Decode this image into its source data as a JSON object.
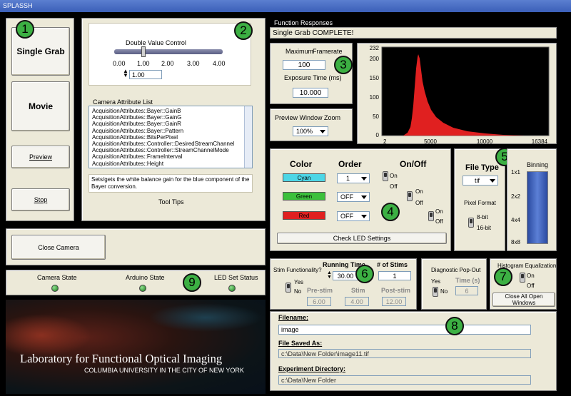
{
  "window": {
    "title": "SPLASSH"
  },
  "left_buttons": {
    "single_grab": "Single Grab",
    "movie": "Movie",
    "preview": "Preview",
    "stop": "Stop"
  },
  "close_camera": "Close Camera",
  "double_value": {
    "title": "Double Value Control",
    "ticks": [
      "0.00",
      "1.00",
      "2.00",
      "3.00",
      "4.00"
    ],
    "value": "1.00",
    "fraction": 0.25
  },
  "attr_list": {
    "title": "Camera Attribute List",
    "items": [
      "AcquisitionAttributes::Bayer::GainB",
      "AcquisitionAttributes::Bayer::GainG",
      "AcquisitionAttributes::Bayer::GainR",
      "AcquisitionAttributes::Bayer::Pattern",
      "AcquisitionAttributes::BitsPerPixel",
      "AcquisitionAttributes::Controller::DesiredStreamChannel",
      "AcquisitionAttributes::Controller::StreamChannelMode",
      "AcquisitionAttributes::FrameInterval",
      "AcquisitionAttributes::Height"
    ]
  },
  "tooltip": {
    "text": "Sets/gets the white balance gain for the blue component of the Bayer conversion.",
    "label": "Tool Tips"
  },
  "status": {
    "camera": "Camera State",
    "arduino": "Arduino State",
    "led": "LED Set Status"
  },
  "logo": {
    "line1": "Laboratory for Functional Optical Imaging",
    "line2": "COLUMBIA UNIVERSITY IN THE CITY OF NEW YORK"
  },
  "responses": {
    "label": "Function Responses",
    "value": "Single Grab COMPLETE!"
  },
  "framerate": {
    "title1": "Maximum",
    "title2": "Framerate",
    "value": "100",
    "exp_label": "Exposure Time (ms)",
    "exp_value": "10.000"
  },
  "zoom": {
    "label": "Preview Window Zoom",
    "value": "100%"
  },
  "histogram": {
    "y_ticks": [
      "232",
      "200",
      "150",
      "100",
      "50",
      "0"
    ],
    "x_ticks": [
      "2",
      "5000",
      "10000",
      "16384"
    ]
  },
  "led": {
    "color": "Color",
    "order": "Order",
    "onoff": "On/Off",
    "on": "On",
    "off": "Off",
    "check": "Check LED Settings",
    "rows": [
      {
        "name": "Cyan",
        "order": "1",
        "color": "#4dd6e6"
      },
      {
        "name": "Green",
        "order": "OFF",
        "color": "#3cc03c"
      },
      {
        "name": "Red",
        "order": "OFF",
        "color": "#e02020"
      }
    ]
  },
  "filetype": {
    "label": "File Type",
    "value": "tif",
    "format": "Pixel Format",
    "bit8": "8-bit",
    "bit16": "16-bit"
  },
  "binning": {
    "label": "Binning",
    "ticks": [
      "1x1",
      "2x2",
      "4x4",
      "8x8"
    ],
    "level": 1.0
  },
  "stim": {
    "func": "Stim Functionality?",
    "yes": "Yes",
    "no": "No",
    "running": "Running Time",
    "running_value": "30.00",
    "nstims": "# of Stims",
    "nstims_value": "1",
    "pre": "Pre-stim",
    "stim": "Stim",
    "post": "Post-stim",
    "pre_value": "6.00",
    "stim_value": "4.00",
    "post_value": "12.00"
  },
  "diag": {
    "label": "Diagnostic Pop-Out",
    "yes": "Yes",
    "no": "No",
    "time": "Time (s)",
    "time_value": "6"
  },
  "histeq": {
    "label": "Histogram Equalization",
    "on": "On",
    "off": "Off",
    "close_all": "Close All Open Windows"
  },
  "files": {
    "filename_label": "Filename:",
    "filename": "image",
    "saved_label": "File Saved As:",
    "saved": "c:\\Data\\New Folder\\image11.tif",
    "expdir_label": "Experiment Directory:",
    "expdir": "c:\\Data\\New Folder"
  },
  "badges": [
    "1",
    "2",
    "3",
    "4",
    "5",
    "6",
    "7",
    "8",
    "9"
  ]
}
